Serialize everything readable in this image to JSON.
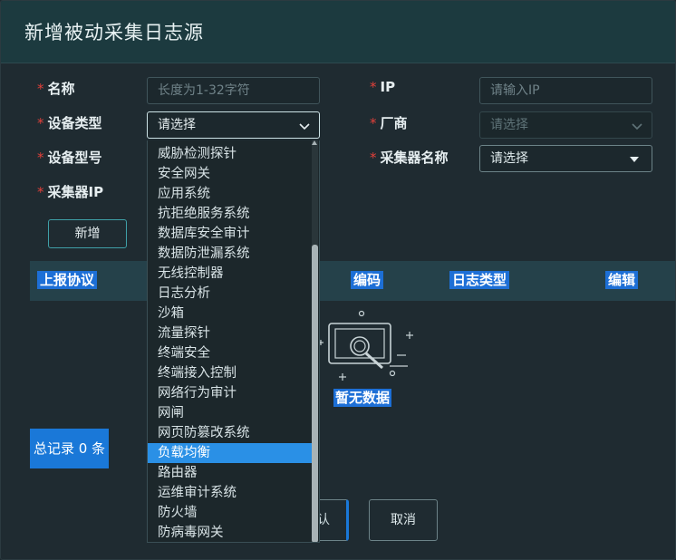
{
  "dialog": {
    "title": "新增被动采集日志源"
  },
  "form": {
    "name": {
      "label": "名称",
      "placeholder": "长度为1-32字符"
    },
    "ip": {
      "label": "IP",
      "placeholder": "请输入IP"
    },
    "device_type": {
      "label": "设备类型",
      "value": "请选择"
    },
    "vendor": {
      "label": "厂商",
      "value": "请选择"
    },
    "device_model": {
      "label": "设备型号"
    },
    "collector_name": {
      "label": "采集器名称",
      "value": "请选择"
    },
    "collector_ip": {
      "label": "采集器IP"
    },
    "required_mark": "*"
  },
  "add_button": "新增",
  "table": {
    "columns": [
      "上报协议",
      "编码",
      "日志类型",
      "编辑"
    ],
    "empty_text": "暂无数据"
  },
  "total": "总记录 0 条",
  "footer": {
    "ok_label": "认",
    "cancel_label": "取消"
  },
  "dropdown": {
    "options": [
      "威胁检测探针",
      "安全网关",
      "应用系统",
      "抗拒绝服务系统",
      "数据库安全审计",
      "数据防泄漏系统",
      "无线控制器",
      "日志分析",
      "沙箱",
      "流量探针",
      "终端安全",
      "终端接入控制",
      "网络行为审计",
      "网闸",
      "网页防篡改系统",
      "负载均衡",
      "路由器",
      "运维审计系统",
      "防火墙",
      "防病毒网关"
    ],
    "selected_index": 15
  }
}
